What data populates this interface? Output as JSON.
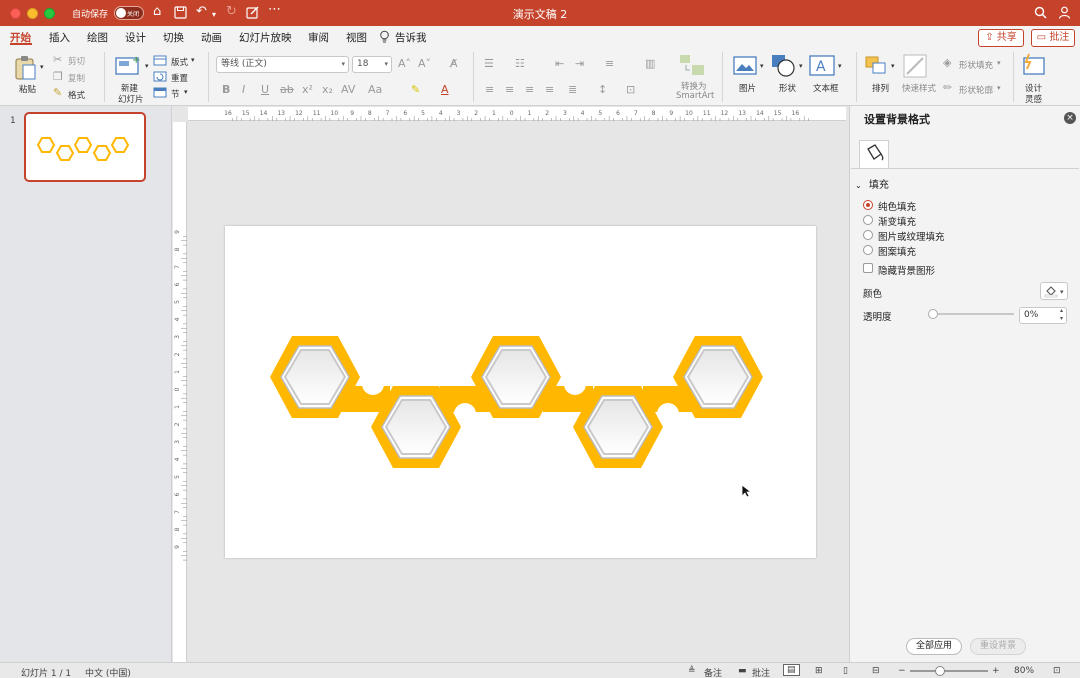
{
  "titlebar": {
    "autosave_label": "自动保存",
    "autosave_state": "关闭",
    "doc_title": "演示文稿 2"
  },
  "tabs": [
    "开始",
    "插入",
    "绘图",
    "设计",
    "切换",
    "动画",
    "幻灯片放映",
    "审阅",
    "视图",
    "告诉我"
  ],
  "header_buttons": {
    "share": "共享",
    "comment": "批注"
  },
  "ribbon": {
    "paste": "粘贴",
    "cut": "剪切",
    "copy": "复制",
    "format": "格式",
    "new_slide": [
      "新建",
      "幻灯片"
    ],
    "layout": "版式",
    "reset": "重置",
    "section": "节",
    "font_name": "等线 (正文)",
    "font_size": "18",
    "convert_smartart": [
      "转换为",
      "SmartArt"
    ],
    "picture": "图片",
    "shape": "形状",
    "textbox": "文本框",
    "arrange": "排列",
    "quick_styles": "快速样式",
    "shape_fill": "形状填充",
    "shape_outline": "形状轮廓",
    "design_ideas": [
      "设计",
      "灵感"
    ]
  },
  "thumbnails": {
    "slide_number": "1"
  },
  "ruler": {
    "h_labels": [
      "16",
      "15",
      "14",
      "13",
      "12",
      "11",
      "10",
      "9",
      "8",
      "7",
      "6",
      "5",
      "4",
      "3",
      "2",
      "1",
      "0",
      "1",
      "2",
      "3",
      "4",
      "5",
      "6",
      "7",
      "8",
      "9",
      "10",
      "11",
      "12",
      "13",
      "14",
      "15",
      "16"
    ],
    "v_labels": [
      "9",
      "8",
      "7",
      "6",
      "5",
      "4",
      "3",
      "2",
      "1",
      "0",
      "1",
      "2",
      "3",
      "4",
      "5",
      "6",
      "7",
      "8",
      "9"
    ]
  },
  "format_pane": {
    "title": "设置背景格式",
    "section": "填充",
    "options": [
      "纯色填充",
      "渐变填充",
      "图片或纹理填充",
      "图案填充"
    ],
    "selected_option": "纯色填充",
    "hide_graphics": "隐藏背景图形",
    "color_label": "颜色",
    "transparency_label": "透明度",
    "transparency_value": "0%",
    "apply_all": "全部应用",
    "reset_background": "重设背景"
  },
  "statusbar": {
    "slide_info": "幻灯片 1 / 1",
    "language": "中文 (中国)",
    "notes": "备注",
    "comments": "批注",
    "zoom": "80%"
  },
  "colors": {
    "accent": "#c5432b",
    "hex_fill": "#ffb700",
    "hex_inner_border": "#c9c9c9"
  }
}
